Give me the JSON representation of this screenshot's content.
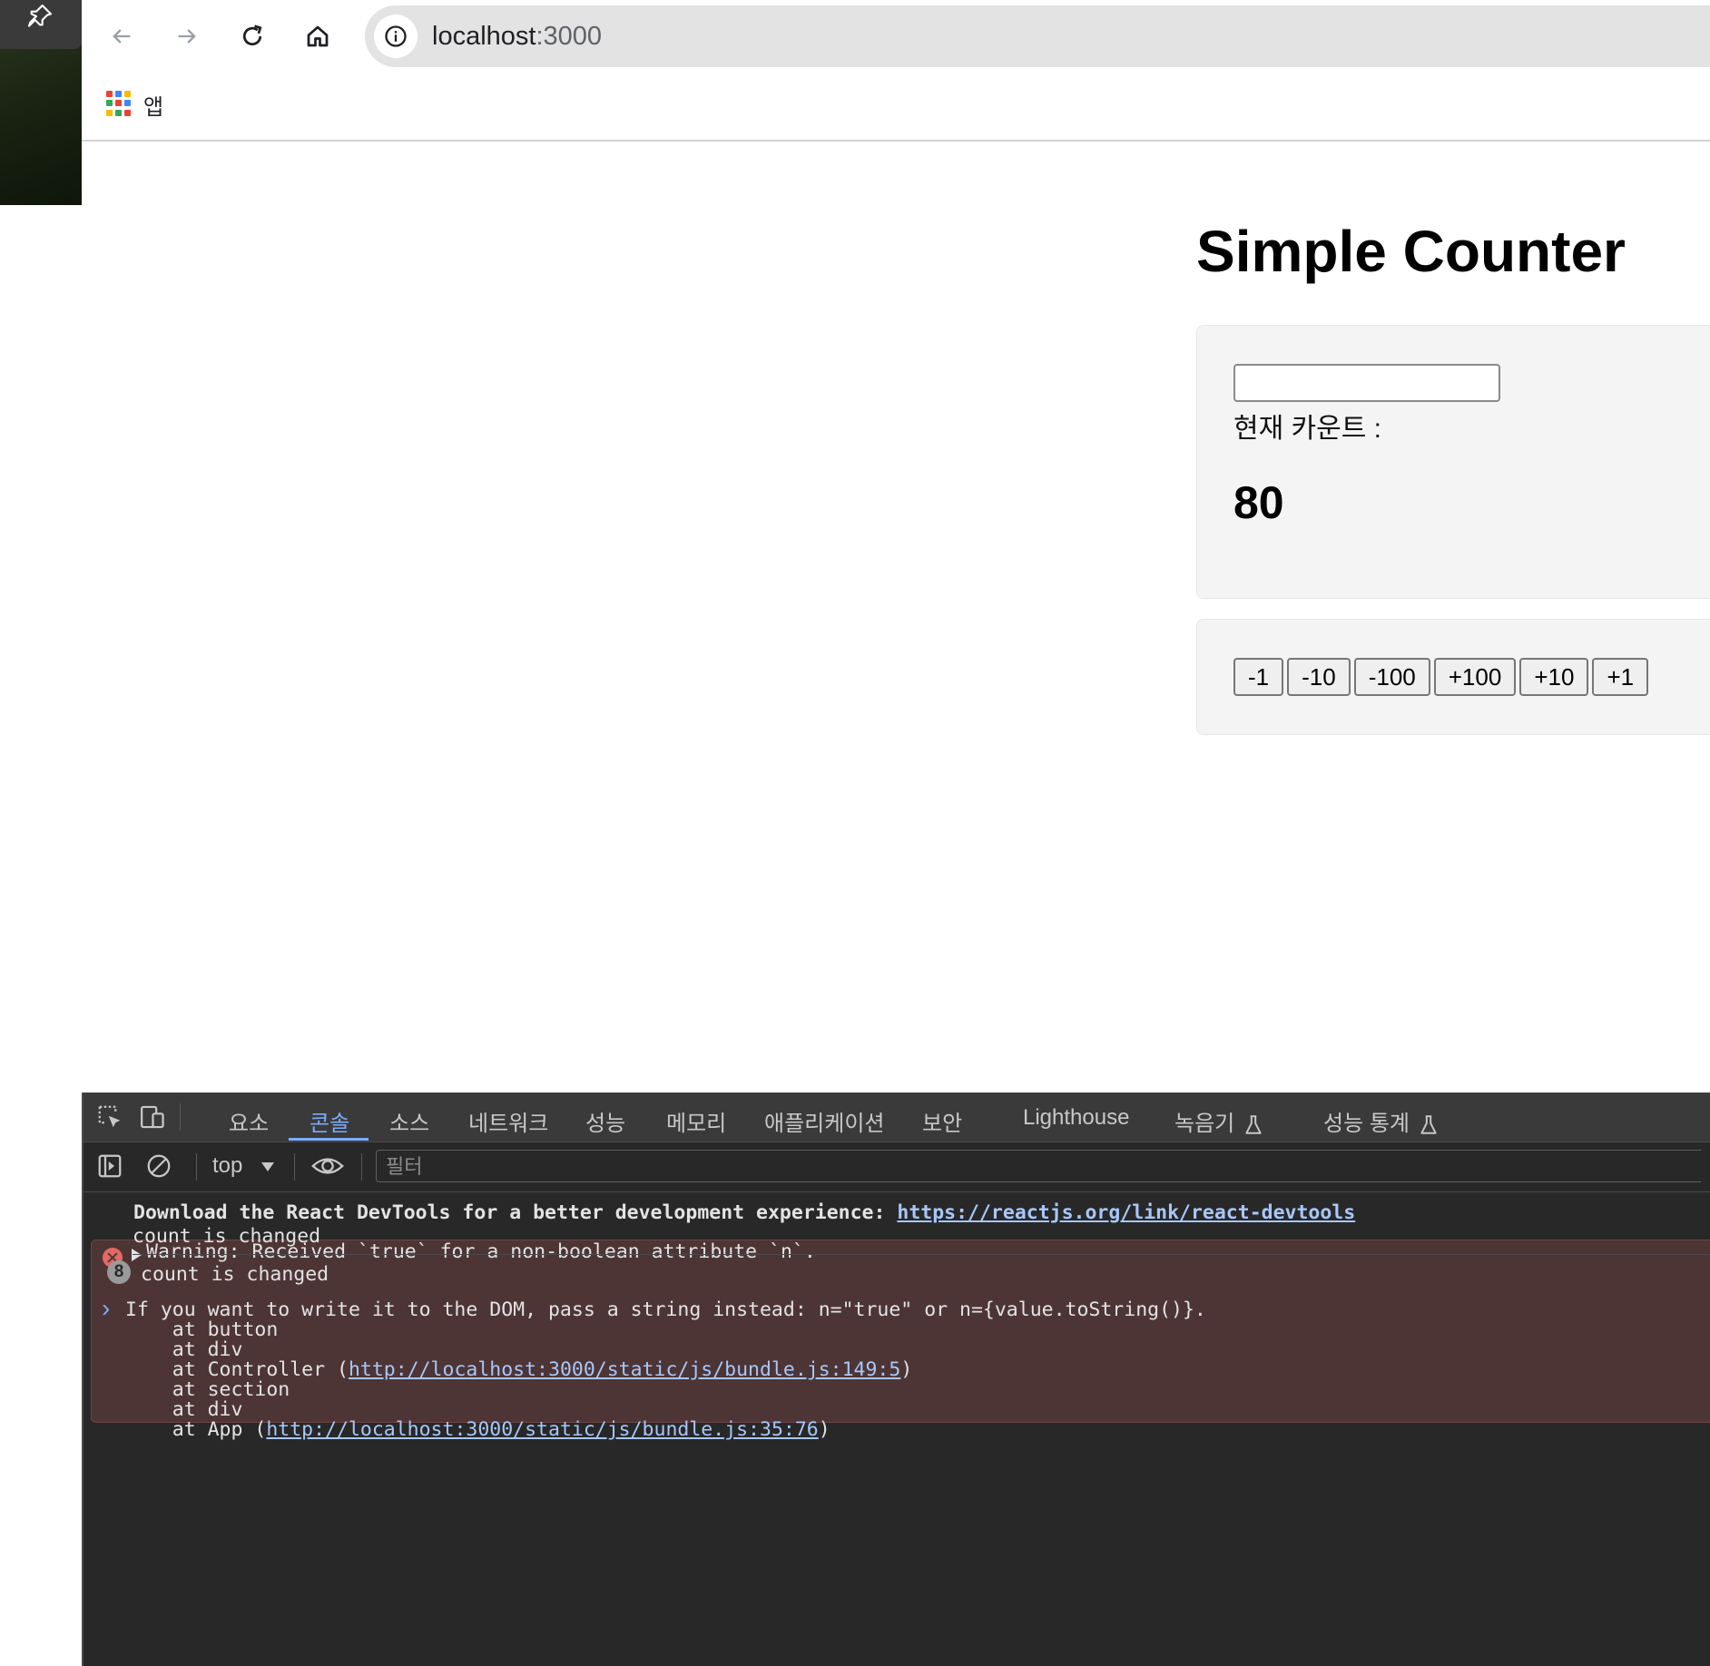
{
  "browser": {
    "nav": {
      "back": "back-arrow-icon",
      "forward": "forward-arrow-icon",
      "reload": "reload-icon",
      "home": "home-icon"
    },
    "address": {
      "host": "localhost",
      "port": ":3000"
    },
    "bookmarks": {
      "apps_label": "앱"
    }
  },
  "page": {
    "title": "Simple Counter",
    "input_value": "",
    "count_label": "현재 카운트 :",
    "count_value": "80",
    "buttons": [
      "-1",
      "-10",
      "-100",
      "+100",
      "+10",
      "+1"
    ]
  },
  "devtools": {
    "tabs": [
      "요소",
      "콘솔",
      "소스",
      "네트워크",
      "성능",
      "메모리",
      "애플리케이션",
      "보안",
      "Lighthouse",
      "녹음기",
      "성능 통계"
    ],
    "active_tab": "콘솔",
    "context": "top",
    "filter_placeholder": "필터",
    "console": {
      "devtools_msg": "Download the React DevTools for a better development experience: ",
      "devtools_link": "https://reactjs.org/link/react-devtools",
      "error": {
        "line1": "Warning: Received `true` for a non-boolean attribute `n`.",
        "line2": "If you want to write it to the DOM, pass a string instead: n=\"true\" or n={value.toString()}.",
        "stack1": "    at button",
        "stack2": "    at div",
        "stack3_prefix": "    at Controller (",
        "stack3_link": "http://localhost:3000/static/js/bundle.js:149:5",
        "stack3_suffix": ")",
        "stack4": "    at section",
        "stack5": "    at div",
        "stack6_prefix": "    at App (",
        "stack6_link": "http://localhost:3000/static/js/bundle.js:35:76",
        "stack6_suffix": ")"
      },
      "log1": "count is changed",
      "log2": "count is changed",
      "log2_repeat": "8",
      "prompt": "›"
    }
  },
  "colors": {
    "accent": "#7cacf8",
    "error_bg": "#4e3535",
    "devtools_bg": "#282828"
  }
}
